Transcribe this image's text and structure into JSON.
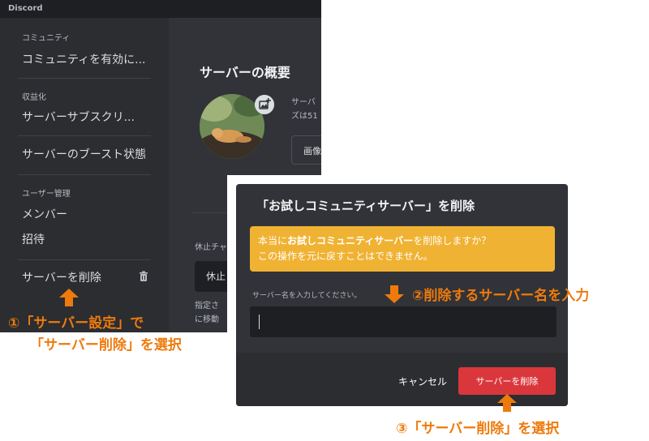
{
  "window": {
    "title": "Discord"
  },
  "sidebar": {
    "community_heading": "コミュニティ",
    "community_item": "コミュニティを有効に...",
    "monetization_heading": "収益化",
    "subscription_item": "サーバーサブスクリ...",
    "boost_item": "サーバーのブースト状態",
    "user_mgmt_heading": "ユーザー管理",
    "members_item": "メンバー",
    "invites_item": "招待",
    "delete_server_item": "サーバーを削除",
    "trash_icon": "trash-icon"
  },
  "overview": {
    "title": "サーバーの概要",
    "text_line1": "サーバ",
    "text_line2": "ズは51",
    "upload_button": "画像",
    "afk_label": "休止チャ",
    "afk_select": "休止",
    "afk_desc_line1": "指定さ",
    "afk_desc_line2": "に移動"
  },
  "modal": {
    "title": "「お試しコミュニティサーバー」を削除",
    "warning_prefix": "本当に",
    "warning_server": "お試しコミュニティサーバー",
    "warning_suffix": "を削除しますか？",
    "warning_line2": "この操作を元に戻すことはできません。",
    "input_label": "サーバー名を入力してください。",
    "input_value": "",
    "cancel_label": "キャンセル",
    "delete_label": "サーバーを削除"
  },
  "annotations": {
    "step1_line1": "①「サーバー設定」で",
    "step1_line2": "「サーバー削除」を選択",
    "step2": "②削除するサーバー名を入力",
    "step3": "③「サーバー削除」を選択"
  },
  "colors": {
    "annotation": "#ee7a0c",
    "warning": "#f0b232",
    "danger": "#da373c"
  }
}
